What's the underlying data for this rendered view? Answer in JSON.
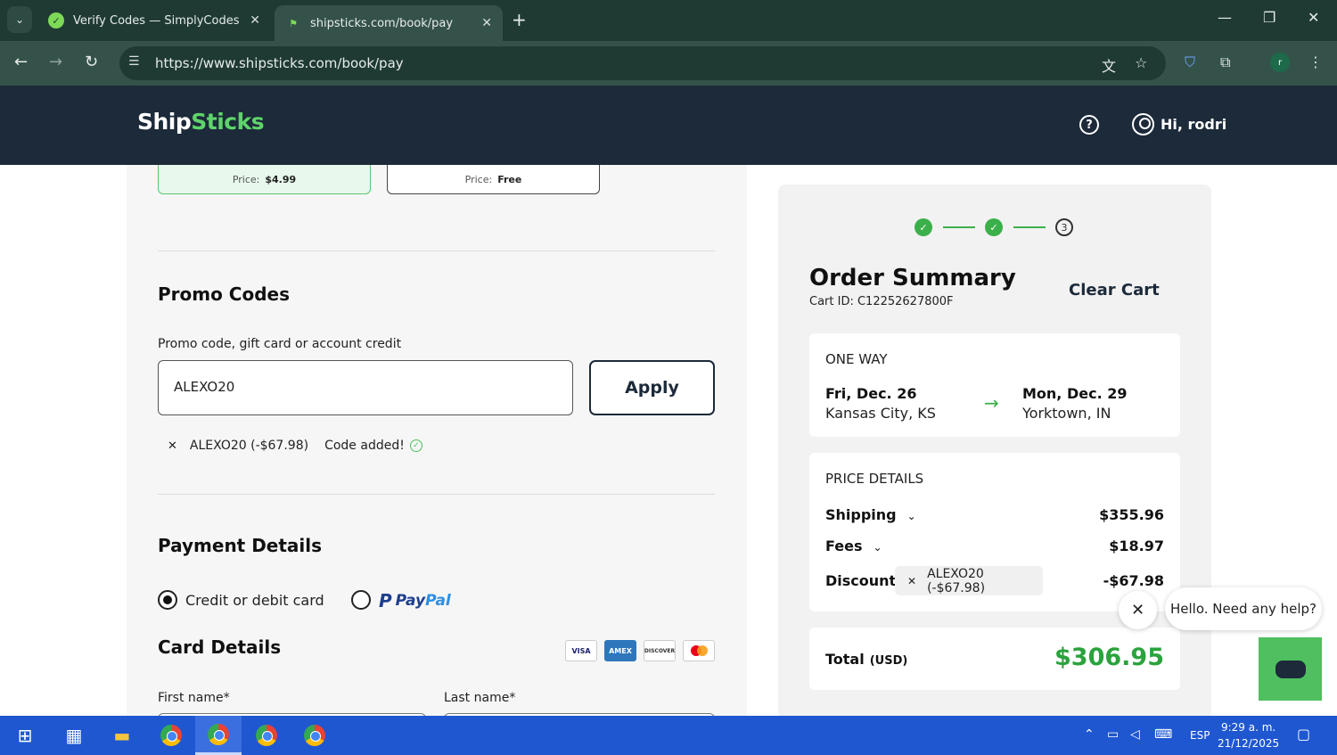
{
  "browser": {
    "tabs": [
      {
        "title": "Verify Codes — SimplyCodes",
        "active": false
      },
      {
        "title": "shipsticks.com/book/pay",
        "active": true
      }
    ],
    "url": "https://www.shipsticks.com/book/pay",
    "profile_initial": "r"
  },
  "site": {
    "logo_main": "Ship",
    "logo_accent": "Sticks",
    "greeting": "Hi, rodri",
    "brand_green": "#5fd46b",
    "header_bg": "#1c2a3a"
  },
  "shipping_options": [
    {
      "price_label": "Price:",
      "price": "$4.99",
      "selected": true
    },
    {
      "price_label": "Price:",
      "price": "Free",
      "selected": false
    }
  ],
  "promo": {
    "title": "Promo Codes",
    "label": "Promo code, gift card or account credit",
    "value": "ALEXO20",
    "apply_label": "Apply",
    "applied_code": "ALEXO20 (-$67.98)",
    "applied_message": "Code added!"
  },
  "payment": {
    "title": "Payment Details",
    "options": [
      {
        "label": "Credit or debit card",
        "selected": true
      },
      {
        "label": "PayPal",
        "selected": false
      }
    ],
    "paypal_p": "Pay",
    "paypal_pal": "Pal"
  },
  "card_details": {
    "title": "Card Details",
    "logos": [
      "VISA",
      "AMEX",
      "DISCOVER",
      "mastercard"
    ],
    "first_name_label": "First name*",
    "last_name_label": "Last name*"
  },
  "summary": {
    "steps": [
      {
        "state": "done"
      },
      {
        "state": "done"
      },
      {
        "state": "current",
        "label": "3"
      }
    ],
    "title": "Order Summary",
    "cart_id": "Cart ID: C12252627800F",
    "clear_cart": "Clear Cart",
    "trip": {
      "type": "ONE WAY",
      "from_date": "Fri, Dec. 26",
      "from_city": "Kansas City, KS",
      "to_date": "Mon, Dec. 29",
      "to_city": "Yorktown, IN"
    },
    "price_details": {
      "title": "PRICE DETAILS",
      "shipping_label": "Shipping",
      "shipping_value": "$355.96",
      "fees_label": "Fees",
      "fees_value": "$18.97",
      "discount_label": "Discount",
      "discount_chip": "ALEXO20 (-$67.98)",
      "discount_value": "-$67.98"
    },
    "total_label": "Total",
    "total_currency": "(USD)",
    "total_value": "$306.95"
  },
  "chat": {
    "message": "Hello. Need any help?"
  },
  "taskbar": {
    "language": "ESP",
    "time": "9:29 a. m.",
    "date": "21/12/2025"
  }
}
